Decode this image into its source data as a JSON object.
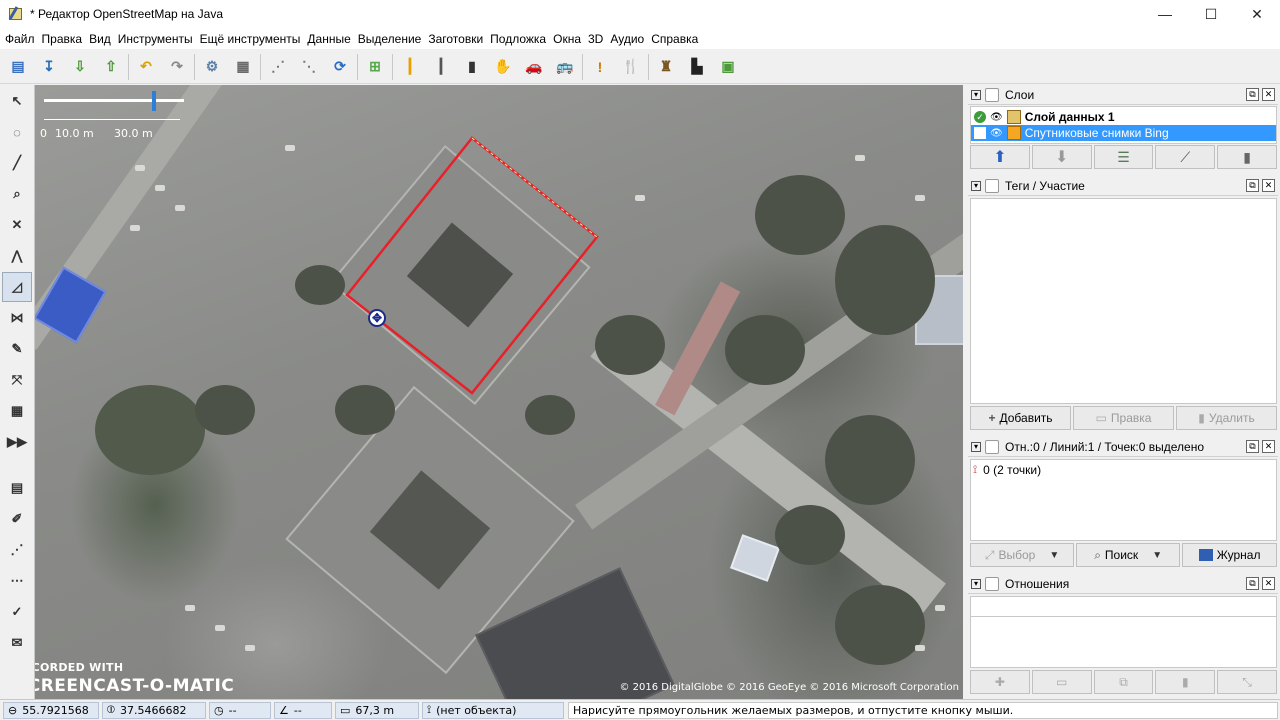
{
  "window": {
    "title": "* Редактор OpenStreetMap на Java",
    "minimize_glyph": "—",
    "maximize_glyph": "☐",
    "close_glyph": "✕"
  },
  "menu": [
    "Файл",
    "Правка",
    "Вид",
    "Инструменты",
    "Ещё инструменты",
    "Данные",
    "Выделение",
    "Заготовки",
    "Подложка",
    "Окна",
    "3D",
    "Аудио",
    "Справка"
  ],
  "toolbar": {
    "groups": [
      [
        {
          "name": "open-icon",
          "color": "#3b6fc0",
          "glyph": "▤"
        },
        {
          "name": "save-icon",
          "color": "#2d6fb5",
          "glyph": "↧"
        },
        {
          "name": "download-icon",
          "color": "#4c9a3a",
          "glyph": "⇩"
        },
        {
          "name": "upload-icon",
          "color": "#4c9a3a",
          "glyph": "⇧"
        }
      ],
      [
        {
          "name": "undo-icon",
          "color": "#d9a400",
          "glyph": "↶"
        },
        {
          "name": "redo-icon",
          "color": "#888888",
          "glyph": "↷"
        }
      ],
      [
        {
          "name": "preferences-icon",
          "color": "#5a7fa8",
          "glyph": "⚙"
        },
        {
          "name": "preferences-map-icon",
          "color": "#6a6a6a",
          "glyph": "▦"
        }
      ],
      [
        {
          "name": "simplify-way-icon",
          "color": "#777777",
          "glyph": "⋰"
        },
        {
          "name": "split-way-icon",
          "color": "#777777",
          "glyph": "⋱"
        },
        {
          "name": "update-data-icon",
          "color": "#2a6bc7",
          "glyph": "⟳"
        }
      ],
      [
        {
          "name": "zoom-to-data-icon",
          "color": "#59a84d",
          "glyph": "⊞"
        }
      ],
      [
        {
          "name": "preset-highway-icon",
          "color": "#e8a000",
          "glyph": "┃"
        },
        {
          "name": "preset-road-icon",
          "color": "#555555",
          "glyph": "┃"
        },
        {
          "name": "preset-lane-icon",
          "color": "#333333",
          "glyph": "▮"
        },
        {
          "name": "hand-icon",
          "color": "#111111",
          "glyph": "✋"
        },
        {
          "name": "car-icon",
          "color": "#222222",
          "glyph": "🚗"
        },
        {
          "name": "bus-icon",
          "color": "#222222",
          "glyph": "🚌"
        }
      ],
      [
        {
          "name": "warning-icon",
          "color": "#cc7a00",
          "glyph": "!"
        },
        {
          "name": "restaurant-icon",
          "color": "#8a5a1a",
          "glyph": "🍴"
        }
      ],
      [
        {
          "name": "castle-icon",
          "color": "#7a5520",
          "glyph": "♜"
        },
        {
          "name": "industrial-icon",
          "color": "#222222",
          "glyph": "▙"
        },
        {
          "name": "building-icon",
          "color": "#4c9a3a",
          "glyph": "▣"
        }
      ]
    ]
  },
  "left_tools": [
    {
      "name": "select-tool-icon",
      "glyph": "↖",
      "active": false
    },
    {
      "name": "lasso-tool-icon",
      "glyph": "◌",
      "active": false
    },
    {
      "name": "draw-tool-icon",
      "glyph": "╱",
      "active": false
    },
    {
      "name": "zoom-tool-icon",
      "glyph": "⌕",
      "active": false
    },
    {
      "name": "delete-tool-icon",
      "glyph": "✕",
      "active": false
    },
    {
      "name": "improve-way-tool-icon",
      "glyph": "⋀",
      "active": false
    },
    {
      "name": "draw-building-tool-icon",
      "glyph": "◿",
      "active": true
    },
    {
      "name": "split-tool-icon",
      "glyph": "⋈",
      "active": false
    },
    {
      "name": "pencil-tool-icon",
      "glyph": "✎",
      "active": false
    },
    {
      "name": "extrude-tool-icon",
      "glyph": "⤧",
      "active": false
    },
    {
      "name": "grid-tool-icon",
      "glyph": "▦",
      "active": false
    },
    {
      "name": "more-tools-icon",
      "glyph": "▶▶",
      "active": false
    },
    {
      "name": "layers-toggle-icon",
      "glyph": "▤",
      "active": false
    },
    {
      "name": "tags-toggle-icon",
      "glyph": "✐",
      "active": false
    },
    {
      "name": "selection-toggle-icon",
      "glyph": "⋰",
      "active": false
    },
    {
      "name": "relations-toggle-icon",
      "glyph": "⋯",
      "active": false
    },
    {
      "name": "validator-toggle-icon",
      "glyph": "✓",
      "active": false
    },
    {
      "name": "notes-toggle-icon",
      "glyph": "✉",
      "active": false
    }
  ],
  "map": {
    "scale_label_1": "0",
    "scale_label_2": "10.0 m",
    "scale_label_3": "30.0 m",
    "copyright": "© 2016 DigitalGlobe © 2016 GeoEye © 2016 Microsoft Corporation",
    "watermark_line1": "RECORDED WITH",
    "watermark_line2": "SCREENCAST-O-MATIC",
    "drawn_shape_color": "#e8202a"
  },
  "layers_panel": {
    "title": "Слои",
    "items": [
      {
        "label": "Слой данных 1",
        "bold": true,
        "selected": false
      },
      {
        "label": "Спутниковые снимки Bing",
        "bold": false,
        "selected": true
      }
    ]
  },
  "tags_panel": {
    "title": "Теги / Участие",
    "add": "Добавить",
    "edit": "Правка",
    "delete": "Удалить"
  },
  "selection_panel": {
    "title": "Отн.:0 / Линий:1 / Точек:0 выделено",
    "items": [
      "0 (2 точки)"
    ],
    "select": "Выбор",
    "search": "Поиск",
    "history": "Журнал"
  },
  "relations_panel": {
    "title": "Отношения"
  },
  "status": {
    "lat": "55.7921568",
    "lon": "37.5466682",
    "heading": "--",
    "angle": "--",
    "distance": "67,3 m",
    "object": "(нет объекта)",
    "message": "Нарисуйте прямоугольник желаемых размеров, и отпустите кнопку мыши."
  }
}
